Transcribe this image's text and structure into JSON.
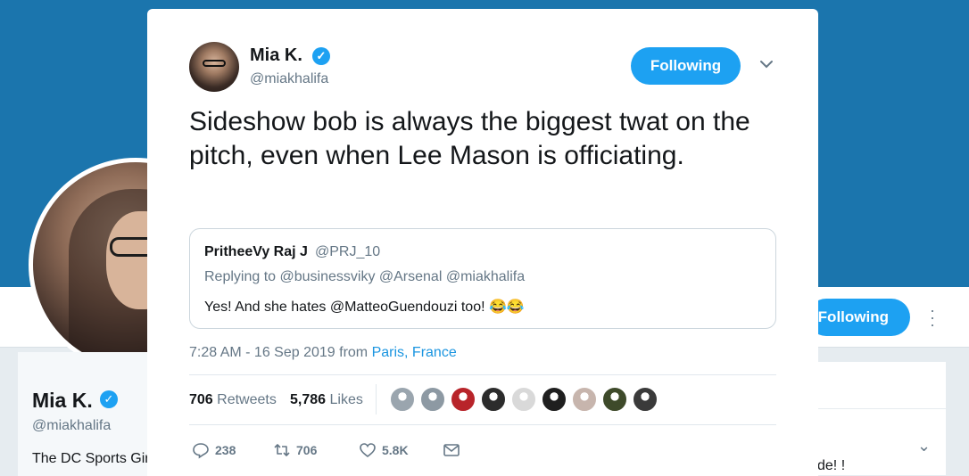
{
  "background_profile": {
    "name": "Mia K.",
    "handle": "@miakhalifa",
    "bio": "The DC Sports Girl",
    "follow_label": "Following",
    "side_text": "de! !"
  },
  "tweet": {
    "author_name": "Mia K.",
    "author_handle": "@miakhalifa",
    "follow_label": "Following",
    "text": "Sideshow bob is always the biggest twat on the pitch, even when Lee Mason is officiating.",
    "quote": {
      "name": "PritheeVy Raj J",
      "handle": "@PRJ_10",
      "reply_to": "Replying to @businessviky @Arsenal @miakhalifa",
      "text": "Yes! And she hates @MatteoGuendouzi too! 😂😂"
    },
    "time": "7:28 AM - 16 Sep 2019",
    "from_label": "from",
    "location": "Paris, France",
    "retweets_count": "706",
    "retweets_label": "Retweets",
    "likes_count": "5,786",
    "likes_label": "Likes",
    "liker_colors": [
      "#9aa5ae",
      "#8d99a3",
      "#b8242a",
      "#2c2c2c",
      "#d9d9d9",
      "#1f1f1f",
      "#c7b5ad",
      "#3e4a2a",
      "#3a3a3a"
    ],
    "actions": {
      "reply_count": "238",
      "retweet_count": "706",
      "like_count": "5.8K"
    }
  },
  "colors": {
    "header_blue": "#1b75ad",
    "accent": "#1da1f2",
    "link": "#1b95e0",
    "muted": "#657786"
  }
}
